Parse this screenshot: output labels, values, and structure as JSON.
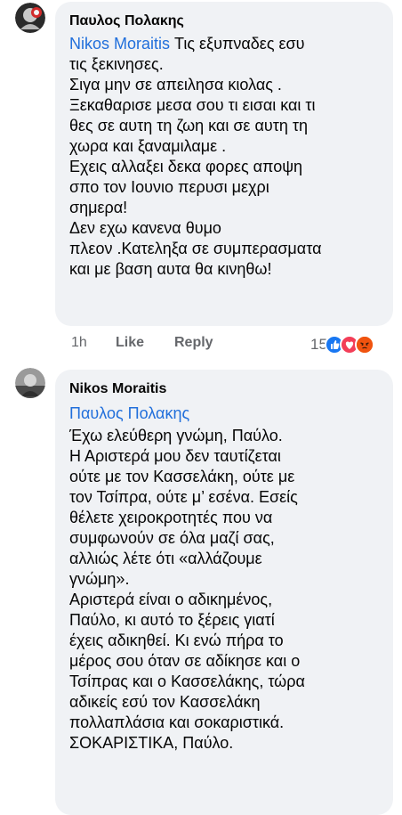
{
  "comments": [
    {
      "author": "Παυλος Πολακης",
      "mention": "Nikos Moraitis",
      "text_first": " Τις εξυπναδες εσυ",
      "lines": [
        "τις ξεκινησες.",
        "Σιγα μην σε απειλησα κιολας .",
        "Ξεκαθαρισε μεσα σου τι εισαι και τι",
        "θες σε αυτη τη ζωη  και σε αυτη τη",
        "χωρα και ξαναμιλαμε .",
        "Εχεις αλλαξει δεκα φορες αποψη",
        "σπο τον Ιουνιο περυσι μεχρι",
        "σημερα!",
        "Δεν εχω κανενα θυμο",
        "πλεον .Κατεληξα σε συμπερασματα",
        "και με βαση αυτα θα κινηθω!"
      ],
      "time": "1h",
      "like_label": "Like",
      "reply_label": "Reply",
      "reaction_count": "15",
      "reactions": [
        "like",
        "love",
        "angry"
      ]
    },
    {
      "author": "Nikos Moraitis",
      "mention": "Παυλος Πολακης",
      "lines": [
        "Έχω ελεύθερη γνώμη, Παύλο.",
        "Η Αριστερά μου δεν ταυτίζεται",
        "ούτε με τον Κασσελάκη, ούτε με",
        "τον Τσίπρα, ούτε μ’ εσένα. Εσείς",
        "θέλετε χειροκροτητές που να",
        "συμφωνούν σε όλα μαζί σας,",
        "αλλιώς λέτε ότι «αλλάζουμε",
        "γνώμη».",
        "Αριστερά είναι ο αδικημένος,",
        "Παύλο, κι αυτό το ξέρεις γιατί",
        "έχεις αδικηθεί. Κι ενώ πήρα το",
        "μέρος σου όταν σε αδίκησε και ο",
        "Τσίπρας και ο Κασσελάκης, τώρα",
        "αδικείς εσύ τον Κασσελάκη",
        "πολλαπλάσια και σοκαριστικά.",
        "ΣΟΚΑΡΙΣΤΙΚΑ, Παύλο."
      ]
    }
  ],
  "colors": {
    "bubble": "#f0f2f5",
    "mention": "#216fdb",
    "meta": "#65676b",
    "like": "#1877f2",
    "love": "#f33e58",
    "angry": "#e9710f"
  }
}
